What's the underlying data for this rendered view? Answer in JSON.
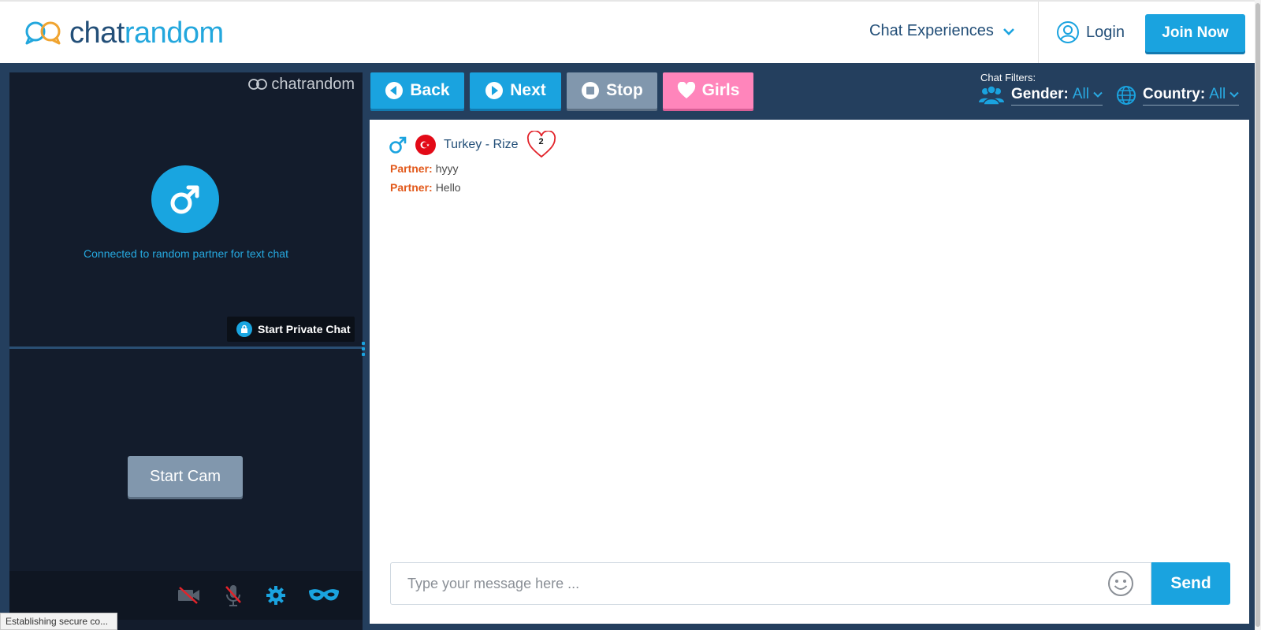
{
  "header": {
    "logo_plain": "chat",
    "logo_accent": "random",
    "nav_experiences": "Chat Experiences",
    "login": "Login",
    "join": "Join Now"
  },
  "left_panel": {
    "watermark": "chatrandom",
    "connected_text": "Connected to random partner for text chat",
    "private_chat": "Start Private Chat",
    "start_cam": "Start Cam",
    "controls": [
      "camera-off-icon",
      "mic-off-icon",
      "gear-icon",
      "mask-icon"
    ]
  },
  "toolbar": {
    "back": "Back",
    "next": "Next",
    "stop": "Stop",
    "girls": "Girls"
  },
  "filters": {
    "label": "Chat Filters:",
    "gender_label": "Gender:",
    "gender_value": "All",
    "country_label": "Country:",
    "country_value": "All"
  },
  "chat": {
    "partner_location": "Turkey - Rize",
    "heart_count": "2",
    "messages": [
      {
        "sender": "Partner:",
        "text": "hyyy"
      },
      {
        "sender": "Partner:",
        "text": "Hello"
      }
    ],
    "input_placeholder": "Type your message here ...",
    "send": "Send"
  },
  "status_bar": "Establishing secure co...",
  "colors": {
    "brand_blue": "#1aa3df",
    "navy": "#234f78",
    "frame": "#243f5e",
    "girls_pink": "#ff85bb",
    "stop_gray": "#8197ad",
    "partner_orange": "#e2591b"
  }
}
